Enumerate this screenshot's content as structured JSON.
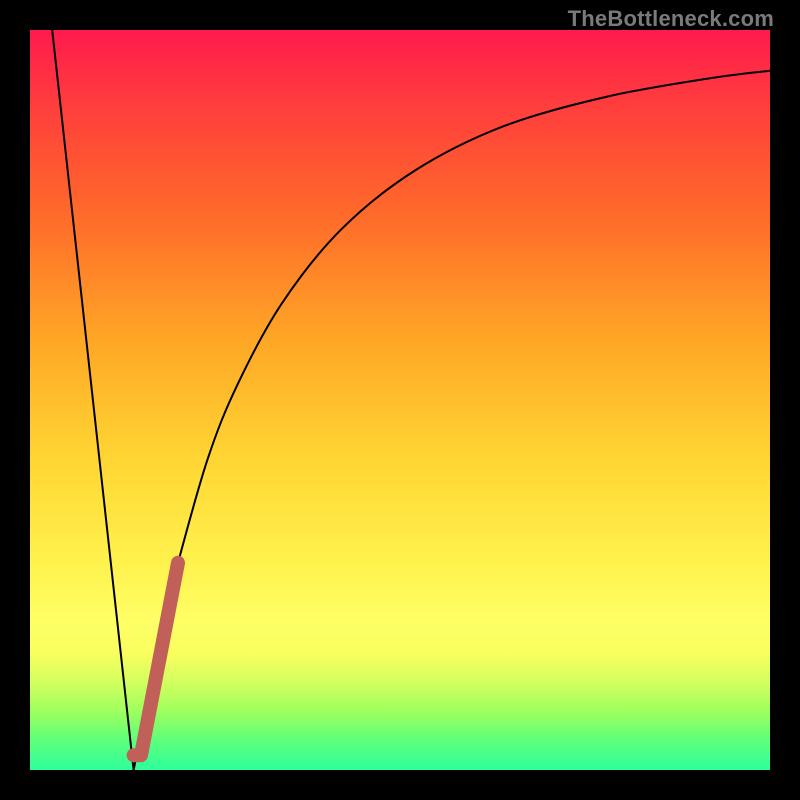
{
  "watermark": "TheBottleneck.com",
  "chart_data": {
    "type": "line",
    "title": "",
    "xlabel": "",
    "ylabel": "",
    "xlim": [
      0,
      100
    ],
    "ylim": [
      0,
      100
    ],
    "grid": false,
    "series": [
      {
        "name": "falling-line",
        "color": "#000000",
        "width": 2,
        "x": [
          3,
          14
        ],
        "values": [
          100,
          0
        ]
      },
      {
        "name": "rising-curve",
        "color": "#000000",
        "width": 2,
        "x": [
          14,
          16,
          18,
          20,
          24,
          28,
          34,
          42,
          52,
          64,
          78,
          92,
          100
        ],
        "values": [
          0,
          10,
          20,
          28,
          42,
          52,
          63,
          73,
          81,
          87,
          91,
          93.5,
          94.5
        ]
      },
      {
        "name": "highlight-segment",
        "color": "#c06058",
        "width": 14,
        "x": [
          14,
          15,
          20
        ],
        "values": [
          2,
          2,
          28
        ]
      }
    ]
  }
}
